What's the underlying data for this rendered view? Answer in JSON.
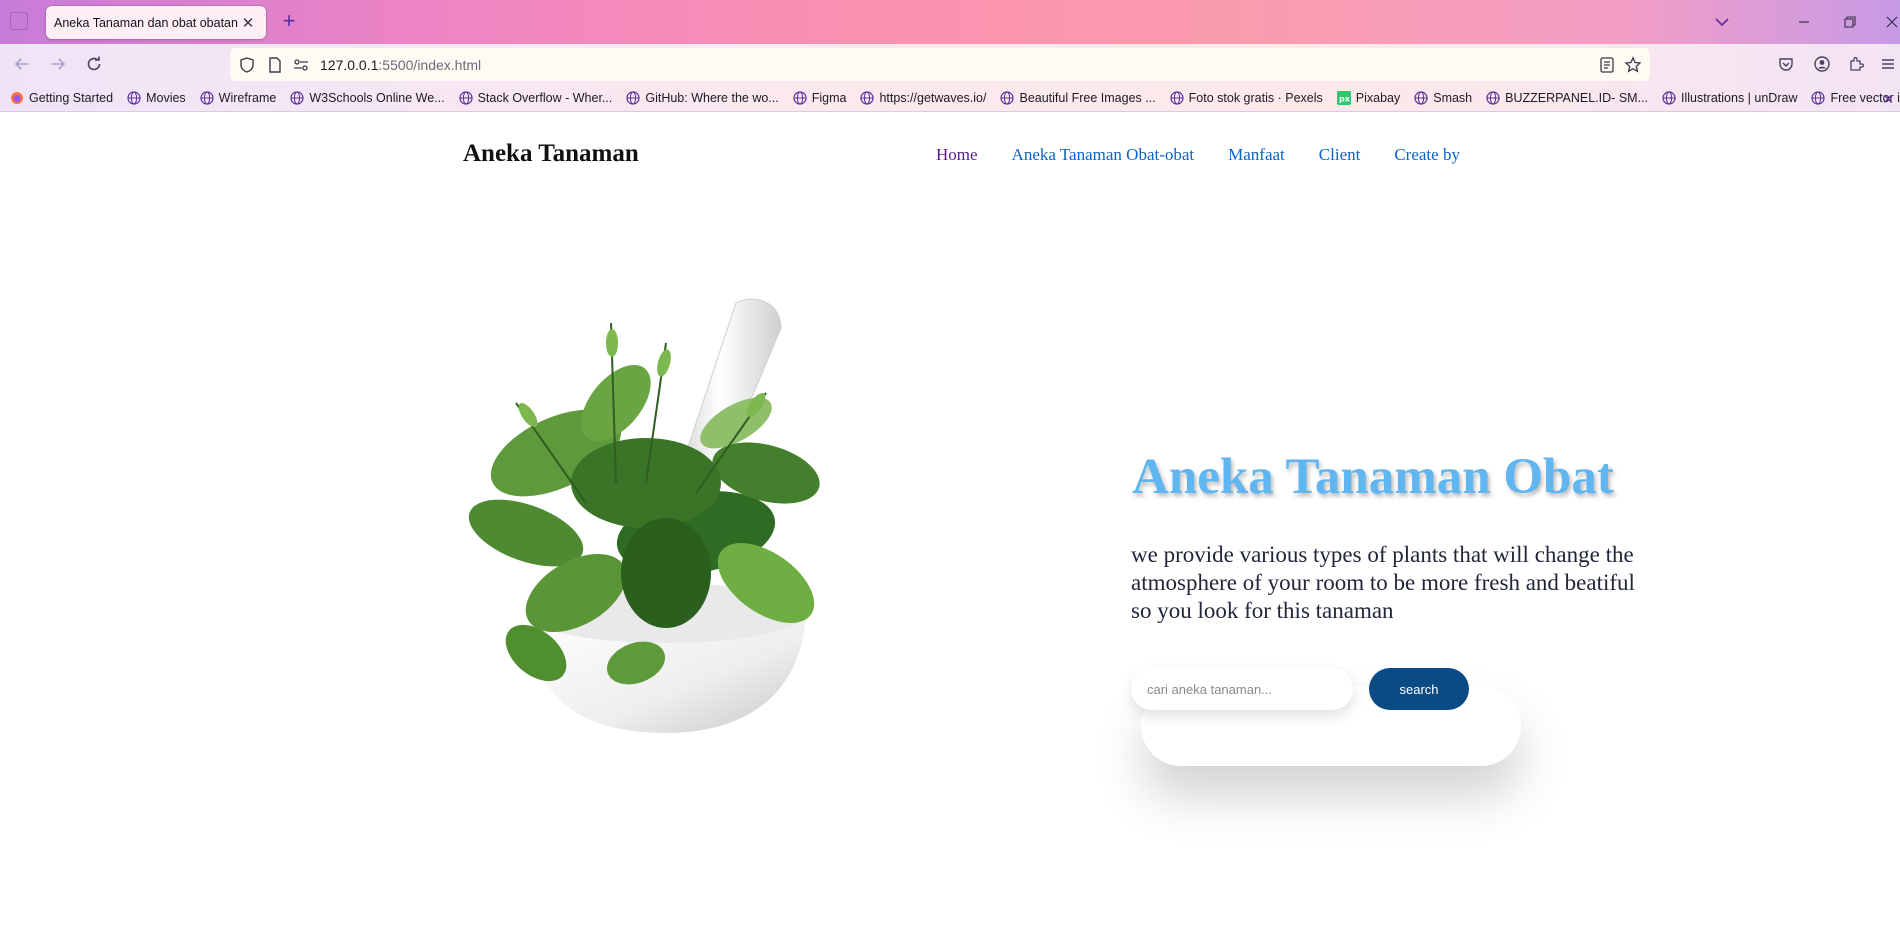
{
  "browser": {
    "tab_title": "Aneka Tanaman dan obat obatan",
    "url_host": "127.0.0.1",
    "url_rest": ":5500/index.html",
    "bookmarks": [
      "Getting Started",
      "Movies",
      "Wireframe",
      "W3Schools Online We...",
      "Stack Overflow - Wher...",
      "GitHub: Where the wo...",
      "Figma",
      "https://getwaves.io/",
      "Beautiful Free Images ...",
      "Foto stok gratis · Pexels",
      "Pixabay",
      "Smash",
      "BUZZERPANEL.ID- SM...",
      "Illustrations | unDraw",
      "Free vector icons - SV..."
    ]
  },
  "site": {
    "brand": "Aneka Tanaman",
    "menu": [
      "Home",
      "Aneka Tanaman Obat-obat",
      "Manfaat",
      "Client",
      "Create by"
    ]
  },
  "hero": {
    "title": "Aneka Tanaman Obat",
    "description": "we provide various types of plants that will change the atmosphere of your room to be more fresh and beatiful so you look for this tanaman",
    "search_placeholder": "cari aneka tanaman...",
    "search_button": "search"
  }
}
